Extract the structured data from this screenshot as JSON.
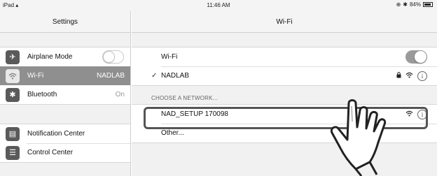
{
  "status_bar": {
    "device": "iPad",
    "time": "11:46 AM",
    "battery": "84%"
  },
  "sidebar": {
    "title": "Settings",
    "group1": [
      {
        "label": "Airplane Mode",
        "icon": "airplane-icon",
        "toggle": "off"
      },
      {
        "label": "Wi-Fi",
        "icon": "wifi-icon",
        "value": "NADLAB",
        "selected": true
      },
      {
        "label": "Bluetooth",
        "icon": "bluetooth-icon",
        "value": "On"
      }
    ],
    "group2": [
      {
        "label": "Notification Center",
        "icon": "notification-center-icon"
      },
      {
        "label": "Control Center",
        "icon": "control-center-icon"
      }
    ]
  },
  "main": {
    "title": "Wi-Fi",
    "wifi_label": "Wi-Fi",
    "wifi_toggle": "on",
    "connected_network": "NADLAB",
    "section_header": "CHOOSE A NETWORK...",
    "networks": [
      {
        "name": "NAD_SETUP 170098",
        "highlighted": true
      },
      {
        "name": "Other..."
      }
    ]
  },
  "colors": {
    "selected_row": "#8f8f8f",
    "toggle_on": "#9a9a9a",
    "highlight_border": "#555555"
  }
}
